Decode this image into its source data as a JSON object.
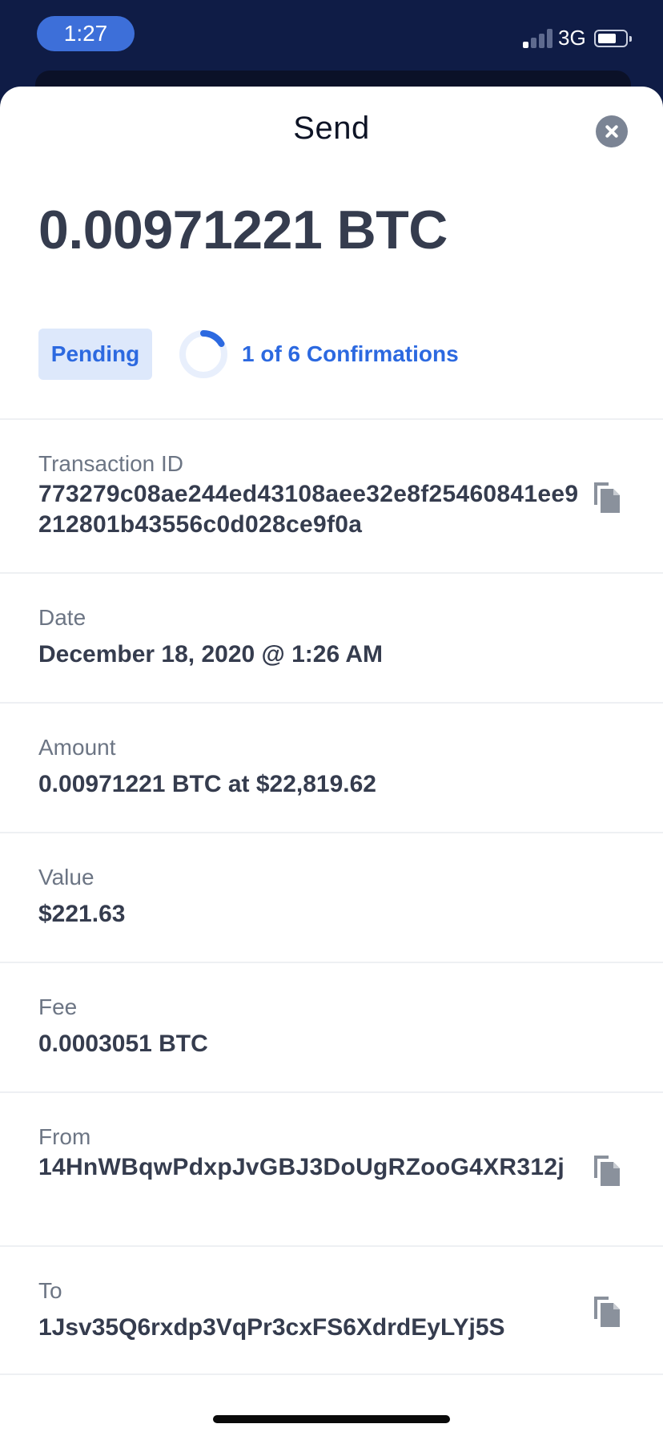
{
  "status_bar": {
    "time": "1:27",
    "network": "3G",
    "signal_bars_on": 1,
    "signal_bars_total": 4,
    "battery_level": 0.55
  },
  "header": {
    "title": "Send",
    "close_icon": "close-icon"
  },
  "amount": "0.00971221 BTC",
  "status": {
    "badge": "Pending",
    "confirmations_text": "1 of 6 Confirmations",
    "confirmations_done": 1,
    "confirmations_total": 6,
    "accent_color": "#2c69e0"
  },
  "details": {
    "transaction_id": {
      "label": "Transaction ID",
      "value": "773279c08ae244ed43108aee32e8f25460841ee9212801b43556c0d028ce9f0a",
      "copy_icon": "copy-icon"
    },
    "date": {
      "label": "Date",
      "value": "December 18, 2020 @ 1:26 AM"
    },
    "amount": {
      "label": "Amount",
      "value": "0.00971221 BTC at $22,819.62"
    },
    "value": {
      "label": "Value",
      "value": "$221.63"
    },
    "fee": {
      "label": "Fee",
      "value": "0.0003051 BTC"
    },
    "from": {
      "label": "From",
      "value": "14HnWBqwPdxpJvGBJ3DoUgRZooG4XR312j",
      "copy_icon": "copy-icon"
    },
    "to": {
      "label": "To",
      "value": "1Jsv35Q6rxdp3VqPr3cxFS6XdrdEyLYj5S",
      "copy_icon": "copy-icon"
    }
  }
}
